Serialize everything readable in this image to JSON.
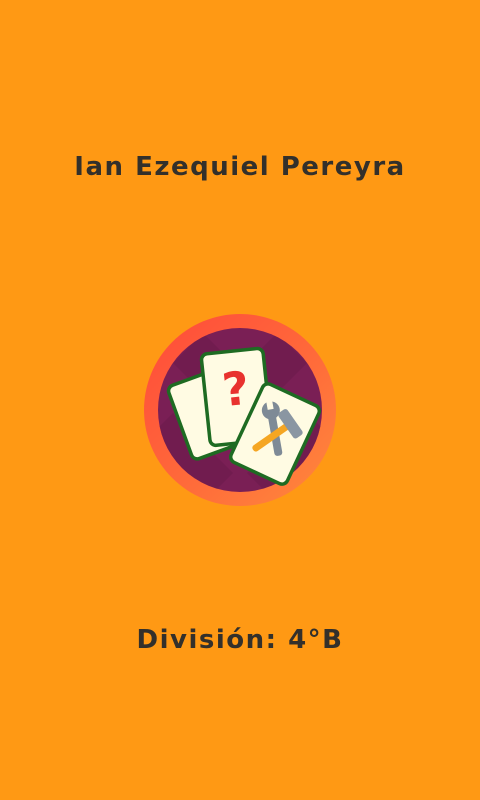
{
  "screen": {
    "student_name": "Ian Ezequiel Pereyra",
    "division_text": "División: 4°B",
    "logo_icon": "cards-question-tools-icon",
    "colors": {
      "background": "#FF9914",
      "text": "#33302B",
      "logo_ring": "#FF5A3C",
      "logo_inner": "#7A1F55",
      "card_fill": "#FFFBE3",
      "card_border": "#1E6B22",
      "question_mark": "#E8322E"
    }
  }
}
